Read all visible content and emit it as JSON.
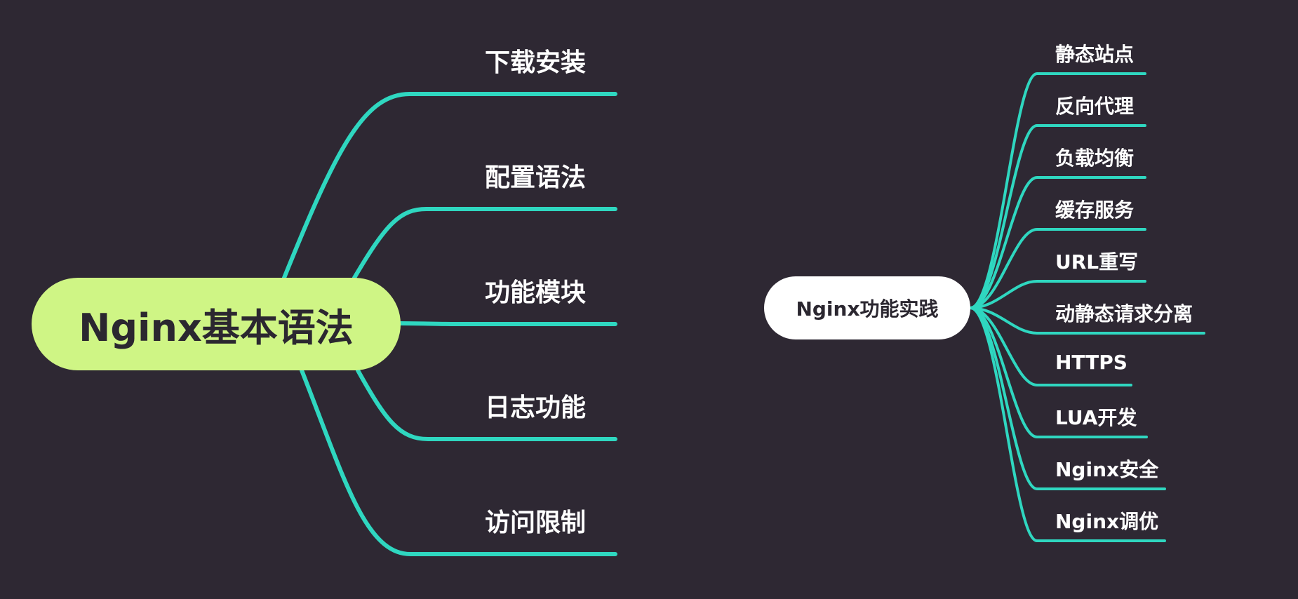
{
  "colors": {
    "background": "#2e2833",
    "line": "#2fd7c0",
    "root1_fill": "#cff585",
    "root2_fill": "#ffffff"
  },
  "map1": {
    "root": "Nginx基本语法",
    "branches": [
      "下载安装",
      "配置语法",
      "功能模块",
      "日志功能",
      "访问限制"
    ]
  },
  "map2": {
    "root": "Nginx功能实践",
    "branches": [
      "静态站点",
      "反向代理",
      "负载均衡",
      "缓存服务",
      "URL重写",
      "动静态请求分离",
      "HTTPS",
      "LUA开发",
      "Nginx安全",
      "Nginx调优"
    ]
  }
}
